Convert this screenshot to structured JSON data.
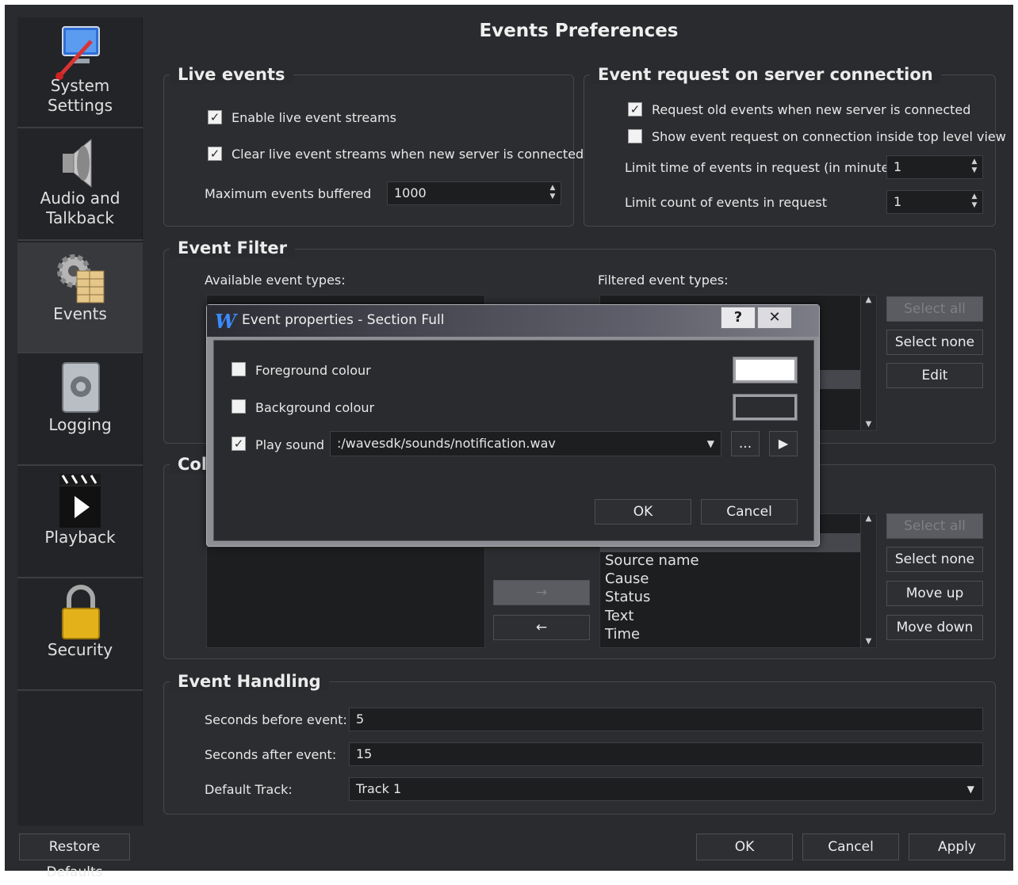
{
  "title": "Events Preferences",
  "sidebar": {
    "items": [
      {
        "label": "System Settings",
        "icon": "monitor-tools-icon"
      },
      {
        "label": "Audio and Talkback",
        "icon": "speaker-icon"
      },
      {
        "label": "Events",
        "icon": "gear-table-icon"
      },
      {
        "label": "Logging",
        "icon": "logbook-icon"
      },
      {
        "label": "Playback",
        "icon": "clapperboard-icon"
      },
      {
        "label": "Security",
        "icon": "padlock-icon"
      }
    ],
    "restore_defaults": "Restore Defaults"
  },
  "live_events": {
    "title": "Live events",
    "enable_label": "Enable live event streams",
    "clear_label": "Clear live event streams when new server is connected",
    "max_label": "Maximum events buffered",
    "max_value": "1000"
  },
  "server_request": {
    "title": "Event request on server connection",
    "request_old_label": "Request old events when new server is connected",
    "show_request_label": "Show event request on connection inside top level view",
    "limit_time_label": "Limit time of events in request (in minutes)",
    "limit_time_value": "1",
    "limit_count_label": "Limit count of events in request",
    "limit_count_value": "1"
  },
  "event_filter": {
    "title": "Event Filter",
    "available_label": "Available event types:",
    "filtered_label": "Filtered event types:",
    "select_all": "Select all",
    "select_none": "Select none",
    "edit": "Edit"
  },
  "columns": {
    "title_partial": "Col",
    "items": [
      "Source name",
      "Cause",
      "Status",
      "Text",
      "Time"
    ],
    "right_arrow": "→",
    "left_arrow": "←",
    "select_all": "Select all",
    "select_none": "Select none",
    "move_up": "Move up",
    "move_down": "Move down"
  },
  "event_handling": {
    "title": "Event Handling",
    "before_label": "Seconds before event:",
    "before_value": "5",
    "after_label": "Seconds after event:",
    "after_value": "15",
    "track_label": "Default Track:",
    "track_value": "Track 1"
  },
  "footer": {
    "ok": "OK",
    "cancel": "Cancel",
    "apply": "Apply"
  },
  "dialog": {
    "logo": "W",
    "title": "Event properties - Section Full",
    "help": "?",
    "close": "✕",
    "fg_label": "Foreground colour",
    "bg_label": "Background colour",
    "sound_label": "Play sound",
    "sound_value": ":/wavesdk/sounds/notification.wav",
    "browse": "...",
    "ok": "OK",
    "cancel": "Cancel",
    "fg_color": "#ffffff",
    "bg_color": "#2c2d31"
  }
}
